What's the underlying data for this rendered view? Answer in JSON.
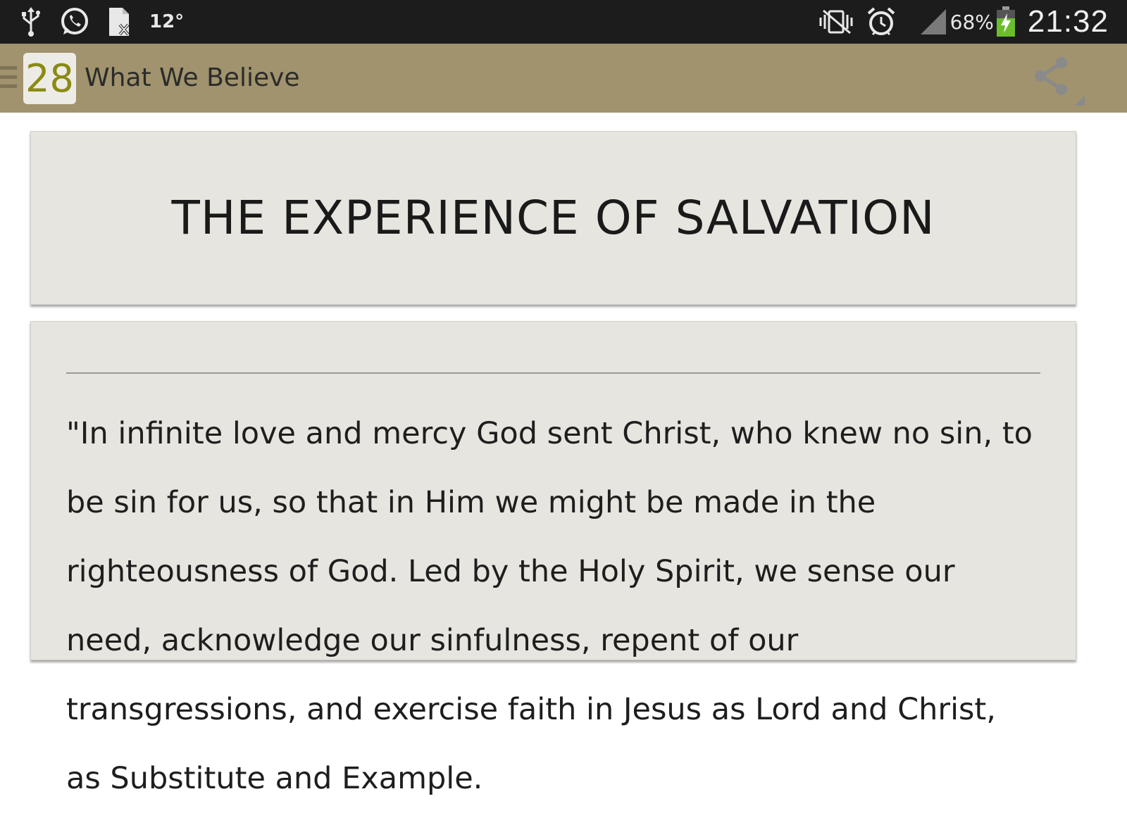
{
  "status_bar": {
    "icons_left": [
      "usb-icon",
      "whatsapp-icon",
      "document-icon"
    ],
    "temperature": "12°",
    "icons_right": [
      "vibrate-mute-icon",
      "alarm-icon",
      "signal-icon",
      "battery-charging-icon"
    ],
    "battery": "68%",
    "time": "21:32",
    "colors": {
      "background": "#1c1c1c",
      "battery_fill": "#6bbd2a"
    }
  },
  "action_bar": {
    "day_number": "28",
    "title": "What We Believe",
    "share_icon": "share-icon",
    "colors": {
      "background": "#a0936d",
      "day_number": "#8a8a14"
    }
  },
  "content": {
    "heading": "THE EXPERIENCE OF SALVATION",
    "body": "\"In infinite love and mercy God sent Christ, who knew no sin, to be sin for us, so that in Him we might be made in the righteousness of God. Led by the Holy Spirit, we sense our need, acknowledge our sinfulness, repent of our transgressions, and exercise faith in Jesus as Lord and Christ, as Substitute and Example."
  }
}
